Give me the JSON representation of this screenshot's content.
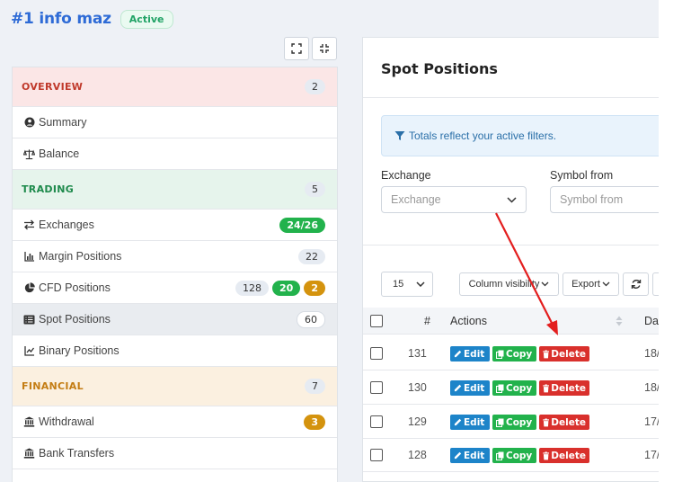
{
  "header": {
    "title": "#1 info maz",
    "status": "Active"
  },
  "sidebar": {
    "sections": [
      {
        "label": "OVERVIEW",
        "count": "2"
      },
      {
        "label": "TRADING",
        "count": "5"
      },
      {
        "label": "FINANCIAL",
        "count": "7"
      }
    ],
    "items": [
      {
        "label": "Summary",
        "icon": "user-circle-icon"
      },
      {
        "label": "Balance",
        "icon": "scale-icon"
      },
      {
        "label": "Exchanges",
        "icon": "exchange-arrows-icon",
        "badges": [
          "24/26"
        ]
      },
      {
        "label": "Margin Positions",
        "icon": "bar-chart-icon",
        "badges": [
          "22"
        ]
      },
      {
        "label": "CFD Positions",
        "icon": "pie-chart-icon",
        "badges": [
          "128",
          "20",
          "2"
        ]
      },
      {
        "label": "Spot Positions",
        "icon": "list-icon",
        "badges": [
          "60"
        ],
        "active": true
      },
      {
        "label": "Binary Positions",
        "icon": "line-chart-icon"
      },
      {
        "label": "Withdrawal",
        "icon": "bank-icon",
        "badges": [
          "3"
        ]
      },
      {
        "label": "Bank Transfers",
        "icon": "bank-icon"
      }
    ]
  },
  "panel": {
    "title": "Spot Positions",
    "info": "Totals reflect your active filters.",
    "filters": {
      "exchange_label": "Exchange",
      "exchange_placeholder": "Exchange",
      "symbol_label": "Symbol from",
      "symbol_placeholder": "Symbol from"
    },
    "toolbar": {
      "page_size": "15",
      "column_visibility": "Column visibility",
      "export": "Export"
    },
    "table": {
      "headers": {
        "id": "#",
        "actions": "Actions",
        "date": "Dat"
      },
      "actions": {
        "edit": "Edit",
        "copy": "Copy",
        "delete": "Delete"
      },
      "rows": [
        {
          "id": "131",
          "date": "18/"
        },
        {
          "id": "130",
          "date": "18/"
        },
        {
          "id": "129",
          "date": "17/"
        },
        {
          "id": "128",
          "date": "17/"
        }
      ]
    }
  },
  "colors": {
    "accent": "#2e6bd6",
    "edit": "#1d84c9",
    "copy": "#22b24c",
    "delete": "#d9302c",
    "arrow": "#e31e1e"
  }
}
